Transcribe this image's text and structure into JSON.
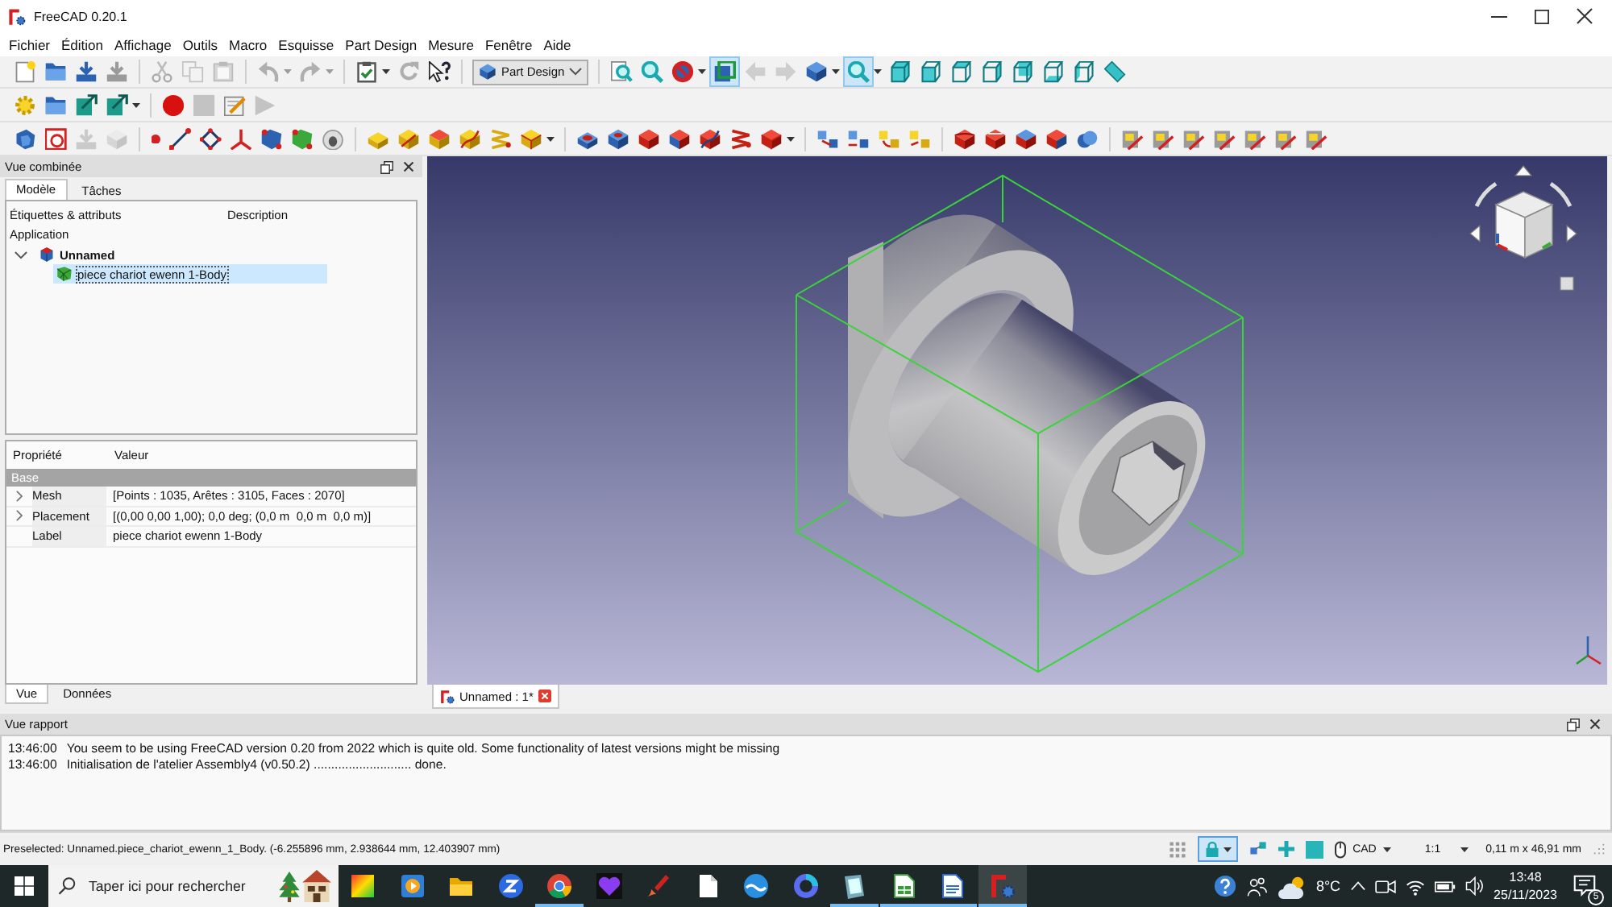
{
  "window": {
    "title": "FreeCAD 0.20.1"
  },
  "menu": [
    "Fichier",
    "Édition",
    "Affichage",
    "Outils",
    "Macro",
    "Esquisse",
    "Part Design",
    "Mesure",
    "Fenêtre",
    "Aide"
  ],
  "toolbars": [
    {
      "items": [
        {
          "kind": "button",
          "disabled": false,
          "on": false
        },
        {
          "kind": "button",
          "disabled": false,
          "on": false
        },
        {
          "kind": "button",
          "disabled": false,
          "on": false
        },
        {
          "kind": "button",
          "disabled": false,
          "on": false
        },
        {
          "kind": "button",
          "disabled": true,
          "on": false
        },
        {
          "kind": "button",
          "disabled": true,
          "on": false
        },
        {
          "kind": "button",
          "disabled": true,
          "on": false
        },
        {
          "kind": "menu",
          "disabled": true,
          "on": false
        },
        {
          "kind": "menu",
          "disabled": true,
          "on": false
        },
        {
          "kind": "menu",
          "disabled": false,
          "on": false
        },
        {
          "kind": "button",
          "disabled": true,
          "on": false
        },
        {
          "kind": "button",
          "disabled": false,
          "on": false
        },
        {
          "kind": "combo",
          "value": "Part Design"
        },
        {
          "kind": "button",
          "disabled": false,
          "on": false
        },
        {
          "kind": "button",
          "disabled": false,
          "on": false
        },
        {
          "kind": "menu",
          "disabled": false,
          "on": false
        },
        {
          "kind": "button",
          "disabled": false,
          "on": true
        },
        {
          "kind": "button",
          "disabled": true,
          "on": false
        },
        {
          "kind": "button",
          "disabled": true,
          "on": false
        },
        {
          "kind": "menu",
          "disabled": false,
          "on": false
        },
        {
          "kind": "menu",
          "disabled": false,
          "on": true
        },
        {
          "kind": "button",
          "disabled": false,
          "on": false
        },
        {
          "kind": "button",
          "disabled": false,
          "on": false
        },
        {
          "kind": "button",
          "disabled": false,
          "on": false
        },
        {
          "kind": "button",
          "disabled": false,
          "on": false
        },
        {
          "kind": "button",
          "disabled": false,
          "on": false
        },
        {
          "kind": "button",
          "disabled": false,
          "on": false
        },
        {
          "kind": "button",
          "disabled": false,
          "on": false
        },
        {
          "kind": "button",
          "disabled": false,
          "on": false
        }
      ]
    },
    {
      "items": [
        {
          "kind": "button",
          "disabled": false,
          "on": false
        },
        {
          "kind": "button",
          "disabled": false,
          "on": false
        },
        {
          "kind": "button",
          "disabled": false,
          "on": false
        },
        {
          "kind": "menu",
          "disabled": false,
          "on": false
        },
        {
          "kind": "button",
          "disabled": false,
          "on": false
        },
        {
          "kind": "button",
          "disabled": true,
          "on": false
        },
        {
          "kind": "button",
          "disabled": false,
          "on": false
        },
        {
          "kind": "button",
          "disabled": true,
          "on": false
        }
      ]
    },
    {
      "items": [
        {
          "kind": "button",
          "disabled": false,
          "on": false
        },
        {
          "kind": "button",
          "disabled": false,
          "on": false
        },
        {
          "kind": "button",
          "disabled": true,
          "on": false
        },
        {
          "kind": "button",
          "disabled": true,
          "on": false
        },
        {
          "kind": "button",
          "disabled": false,
          "on": false
        },
        {
          "kind": "button",
          "disabled": false,
          "on": false
        },
        {
          "kind": "button",
          "disabled": false,
          "on": false
        },
        {
          "kind": "button",
          "disabled": false,
          "on": false
        },
        {
          "kind": "button",
          "disabled": false,
          "on": false
        },
        {
          "kind": "button",
          "disabled": false,
          "on": false
        },
        {
          "kind": "button",
          "disabled": false,
          "on": false
        },
        {
          "kind": "button",
          "disabled": false,
          "on": false
        },
        {
          "kind": "button",
          "disabled": false,
          "on": false
        },
        {
          "kind": "button",
          "disabled": false,
          "on": false
        },
        {
          "kind": "button",
          "disabled": false,
          "on": false
        },
        {
          "kind": "button",
          "disabled": false,
          "on": false
        },
        {
          "kind": "menu",
          "disabled": false,
          "on": false
        },
        {
          "kind": "button",
          "disabled": false,
          "on": false
        },
        {
          "kind": "button",
          "disabled": false,
          "on": false
        },
        {
          "kind": "button",
          "disabled": false,
          "on": false
        },
        {
          "kind": "button",
          "disabled": false,
          "on": false
        },
        {
          "kind": "button",
          "disabled": false,
          "on": false
        },
        {
          "kind": "button",
          "disabled": false,
          "on": false
        },
        {
          "kind": "menu",
          "disabled": false,
          "on": false
        },
        {
          "kind": "button",
          "disabled": false,
          "on": false
        },
        {
          "kind": "button",
          "disabled": false,
          "on": false
        },
        {
          "kind": "button",
          "disabled": false,
          "on": false
        },
        {
          "kind": "button",
          "disabled": false,
          "on": false
        },
        {
          "kind": "button",
          "disabled": false,
          "on": false
        },
        {
          "kind": "button",
          "disabled": false,
          "on": false
        },
        {
          "kind": "button",
          "disabled": false,
          "on": false
        },
        {
          "kind": "button",
          "disabled": false,
          "on": false
        },
        {
          "kind": "button",
          "disabled": false,
          "on": false
        },
        {
          "kind": "button",
          "disabled": false,
          "on": false
        },
        {
          "kind": "button",
          "disabled": false,
          "on": false
        },
        {
          "kind": "button",
          "disabled": false,
          "on": false
        },
        {
          "kind": "button",
          "disabled": false,
          "on": false
        },
        {
          "kind": "button",
          "disabled": false,
          "on": false
        },
        {
          "kind": "button",
          "disabled": false,
          "on": false
        },
        {
          "kind": "button",
          "disabled": false,
          "on": false
        }
      ]
    }
  ],
  "combo_view": {
    "title": "Vue combinée",
    "tabs": [
      {
        "label": "Modèle",
        "selected": true
      },
      {
        "label": "Tâches",
        "selected": false
      }
    ],
    "tree": {
      "columns": [
        "Étiquettes & attributs",
        "Description"
      ],
      "root": "Application",
      "items": [
        {
          "kind": "document",
          "label": "Unnamed",
          "expanded": true,
          "selected": false,
          "children": [
            {
              "kind": "mesh",
              "label": "piece chariot ewenn 1-Body",
              "selected": true
            }
          ]
        }
      ]
    },
    "properties": {
      "columns": [
        "Propriété",
        "Valeur"
      ],
      "groups": [
        {
          "label": "Base",
          "rows": [
            {
              "name": "Mesh",
              "value": "[Points : 1035, Arêtes : 3105, Faces : 2070]",
              "expandable": true
            },
            {
              "name": "Placement",
              "value": "[(0,00 0,00 1,00); 0,0 deg; (0,0 m  0,0 m  0,0 m)]",
              "expandable": true
            },
            {
              "name": "Label",
              "value": "piece chariot ewenn 1-Body",
              "expandable": false
            }
          ]
        }
      ]
    },
    "bottom_tabs": [
      {
        "label": "Vue",
        "selected": true
      },
      {
        "label": "Données",
        "selected": false
      }
    ]
  },
  "viewer": {
    "tabs": [
      {
        "label": "Unnamed : 1*",
        "selected": true
      }
    ]
  },
  "report": {
    "title": "Vue rapport",
    "lines": [
      {
        "time": "13:46:00",
        "text": "You seem to be using FreeCAD version 0.20 from 2022 which is quite old. Some functionality of latest versions might be missing"
      },
      {
        "time": "13:46:00",
        "text": "Initialisation de l'atelier Assembly4 (v0.50.2) ............................ done."
      }
    ]
  },
  "status_bar": {
    "message": "Preselected: Unnamed.piece_chariot_ewenn_1_Body. (-6.255896 mm, 2.938644 mm, 12.403907 mm)",
    "lock": {
      "on": true
    },
    "navigation": "CAD",
    "scale": "1:1",
    "dimensions": "0,11 m x 46,91 mm"
  },
  "taskbar": {
    "search_placeholder": "Taper ici pour rechercher",
    "apps": [
      {
        "running": false,
        "selected": false
      },
      {
        "running": false,
        "selected": false
      },
      {
        "running": false,
        "selected": false
      },
      {
        "running": false,
        "selected": false
      },
      {
        "running": true,
        "selected": false
      },
      {
        "running": false,
        "selected": false
      },
      {
        "running": false,
        "selected": false
      },
      {
        "running": false,
        "selected": false
      },
      {
        "running": false,
        "selected": false
      },
      {
        "running": false,
        "selected": false
      },
      {
        "running": true,
        "selected": false
      },
      {
        "running": true,
        "selected": false
      },
      {
        "running": true,
        "selected": false
      },
      {
        "running": true,
        "selected": true
      }
    ],
    "temperature": "8°C",
    "time": "13:48",
    "date": "25/11/2023",
    "notifications": "5"
  }
}
